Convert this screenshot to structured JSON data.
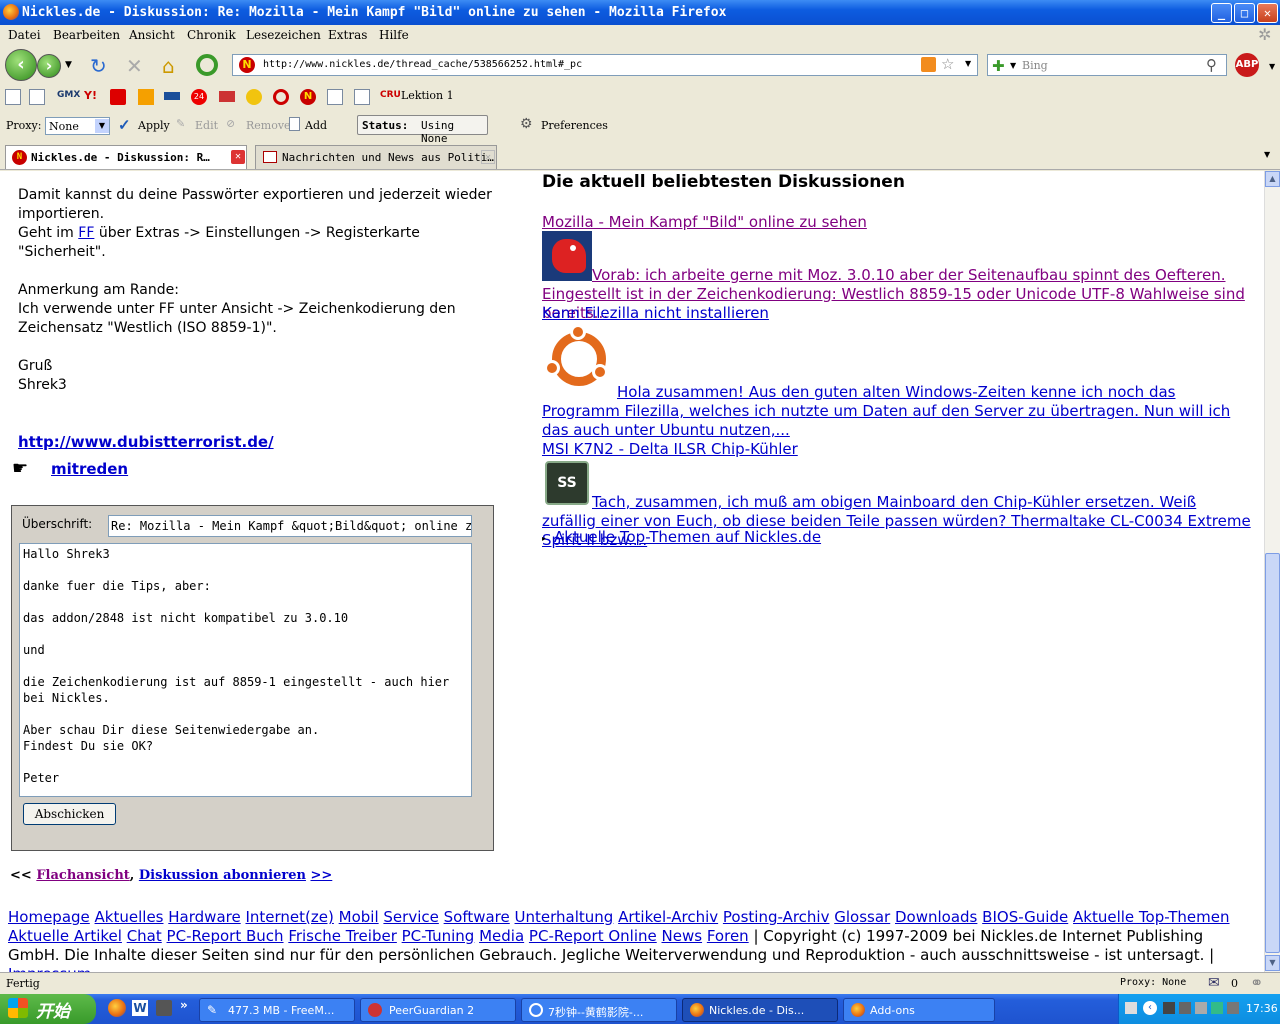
{
  "window": {
    "title": "Nickles.de - Diskussion: Re: Mozilla - Mein Kampf \"Bild\" online zu sehen - Mozilla Firefox"
  },
  "menubar": [
    "Datei",
    "Bearbeiten",
    "Ansicht",
    "Chronik",
    "Lesezeichen",
    "Extras",
    "Hilfe"
  ],
  "navbar": {
    "url": "http://www.nickles.de/thread_cache/538566252.html#_pc",
    "search_placeholder": "Bing"
  },
  "bookmarks": {
    "lektion_label": "Lektion 1",
    "gmx": "GMX"
  },
  "proxybar": {
    "proxy_label": "Proxy:",
    "proxy_value": "None",
    "apply": "Apply",
    "edit": "Edit",
    "remove": "Remove",
    "add": "Add",
    "status_label": "Status:",
    "status_value": "Using None",
    "preferences": "Preferences"
  },
  "tabs": [
    {
      "label": "Nickles.de - Diskussion: R…",
      "active": true
    },
    {
      "label": "Nachrichten und News aus Politi…",
      "active": false
    }
  ],
  "post": {
    "line1": "Damit kannst du deine Passwörter exportieren und jederzeit wieder importieren.",
    "line2_pre": "Geht im ",
    "line2_link": "FF",
    "line2_post": " über Extras -> Einstellungen -> Registerkarte \"Sicherheit\".",
    "line3": "Anmerkung am Rande:",
    "line4": "Ich verwende unter FF unter Ansicht -> Zeichenkodierung den Zeichensatz \"Westlich (ISO 8859-1)\".",
    "greet": "Gruß",
    "author": "Shrek3",
    "sig_link": "http://www.dubistterrorist.de/",
    "mitreden": "mitreden"
  },
  "form": {
    "subject_label": "Überschrift:",
    "subject_value": "Re: Mozilla  -  Mein Kampf &quot;Bild&quot; online zu sehen",
    "message": "Hallo Shrek3\n\ndanke fuer die Tips, aber:\n\ndas addon/2848 ist nicht kompatibel zu 3.0.10\n\nund\n\ndie Zeichenkodierung ist auf 8859-1 eingestellt - auch hier bei Nickles.\n\nAber schau Dir diese Seitenwiedergabe an.\nFindest Du sie OK?\n\nPeter",
    "submit": "Abschicken"
  },
  "threadnav": {
    "prev": "<<",
    "flat": "Flachansicht",
    "subscribe": "Diskussion abonnieren",
    "next": ">>"
  },
  "popular": {
    "heading": "Die aktuell beliebtesten Diskussionen",
    "items": [
      {
        "title": "Mozilla - Mein Kampf \"Bild\" online zu sehen",
        "excerpt": "Vorab: ich arbeite gerne mit Moz. 3.0.10 aber der Seitenaufbau spinnt des Oefteren. Eingestellt ist in der Zeichenkodierung: Westlich 8859-15 oder Unicode UTF-8 Wahlweise sind bereits..."
      },
      {
        "title": "Kann Filezilla nicht installieren",
        "excerpt": "Hola zusammen! Aus den guten alten Windows-Zeiten kenne ich noch das Programm Filezilla, welches ich nutzte um Daten auf den Server zu übertragen. Nun will ich das auch unter Ubuntu nutzen,..."
      },
      {
        "title": "MSI K7N2 - Delta ILSR Chip-Kühler",
        "excerpt": "Tach, zusammen, ich muß am obigen Mainboard den Chip-Kühler ersetzen. Weiß zufällig einer von Euch, ob diese beiden Teile passen würden? Thermaltake CL-C0034 Extreme Spirit II bzw...."
      }
    ],
    "more": "Aktuelle Top-Themen auf Nickles.de"
  },
  "footer": {
    "links": [
      "Homepage",
      "Aktuelles",
      "Hardware",
      "Internet(ze)",
      "Mobil",
      "Service",
      "Software",
      "Unterhaltung",
      "Artikel-Archiv",
      "Posting-Archiv",
      "Glossar",
      "Downloads",
      "BIOS-Guide",
      "Aktuelle Top-Themen",
      "Aktuelle Artikel",
      "Chat",
      "PC-Report Buch",
      "Frische Treiber",
      "PC-Tuning",
      "Media",
      "PC-Report Online",
      "News",
      "Foren"
    ],
    "copyright": "| Copyright (c) 1997-2009 bei Nickles.de Internet Publishing GmbH. Die Inhalte dieser Seiten sind nur für den persönlichen Gebrauch. Jegliche Weiterverwendung und Reproduktion - auch ausschnittsweise - ist untersagt. |",
    "impressum": "Impressum"
  },
  "statusbar": {
    "status": "Fertig",
    "proxy": "Proxy: None",
    "mail_count": "0"
  },
  "taskbar": {
    "start": "开始",
    "tasks": [
      "477.3 MB - FreeM...",
      "PeerGuardian 2",
      "7秒钟--黄鹤影院-...",
      "Nickles.de - Dis...",
      "Add-ons"
    ],
    "clock": "17:36"
  },
  "colors": {
    "link": "#0000cc",
    "visited": "#800080",
    "accent": "#0a4fd0"
  }
}
